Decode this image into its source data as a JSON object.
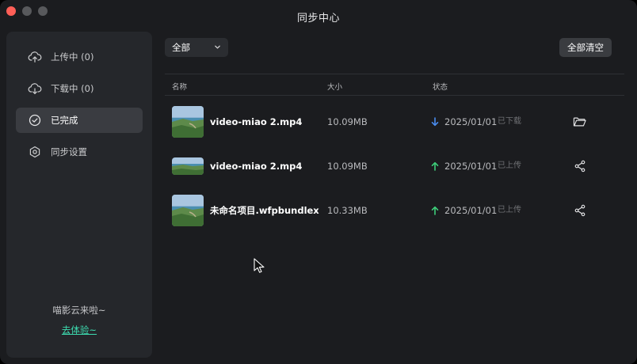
{
  "window": {
    "title": "同步中心"
  },
  "sidebar": {
    "items": [
      {
        "label": "上传中 (0)",
        "icon": "cloud-upload-icon",
        "active": false
      },
      {
        "label": "下载中 (0)",
        "icon": "cloud-download-icon",
        "active": false
      },
      {
        "label": "已完成",
        "icon": "check-circle-icon",
        "active": true
      },
      {
        "label": "同步设置",
        "icon": "gear-icon",
        "active": false
      }
    ],
    "promo": {
      "text": "喵影云来啦~",
      "link": "去体验~"
    }
  },
  "toolbar": {
    "filter_value": "全部",
    "clear_all_label": "全部清空"
  },
  "table": {
    "columns": {
      "name": "名称",
      "size": "大小",
      "status": "状态"
    },
    "rows": [
      {
        "name": "video-miao 2.mp4",
        "size": "10.09MB",
        "direction": "download",
        "date": "2025/01/01",
        "status": "已下载",
        "action": "folder-icon"
      },
      {
        "name": "video-miao 2.mp4",
        "size": "10.09MB",
        "direction": "upload",
        "date": "2025/01/01",
        "status": "已上传",
        "action": "share-icon"
      },
      {
        "name": "未命名项目.wfpbundlex",
        "size": "10.33MB",
        "direction": "upload",
        "date": "2025/01/01",
        "status": "已上传",
        "action": "share-icon"
      }
    ]
  },
  "colors": {
    "accent": "#3ddcb0",
    "download_arrow": "#4a8df0",
    "upload_arrow": "#3ecf7a",
    "background": "#1b1c1f",
    "sidebar": "#25272b"
  }
}
